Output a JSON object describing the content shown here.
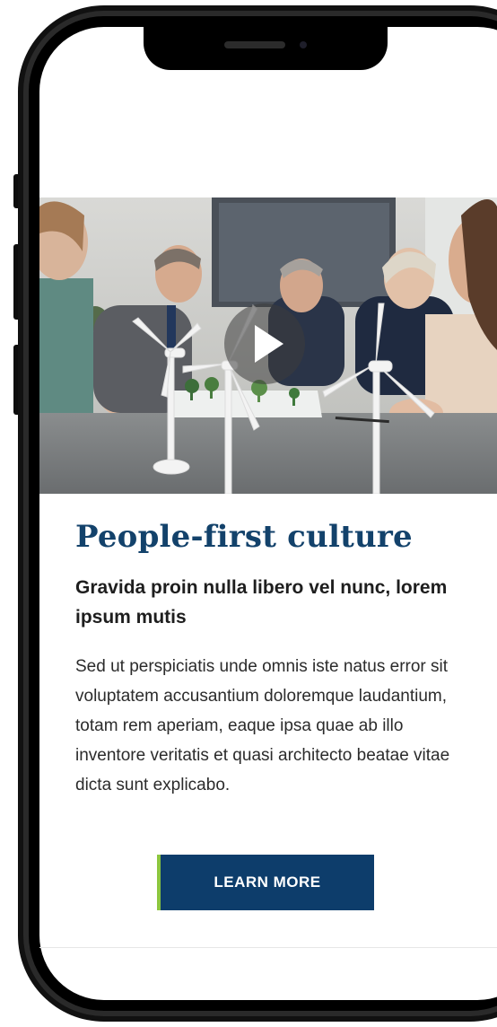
{
  "hero": {
    "media": "video-thumbnail",
    "play_icon": "play-icon"
  },
  "article": {
    "title": "People-first culture",
    "subtitle": "Gravida proin nulla libero vel nunc, lorem ipsum mutis",
    "body": "Sed ut perspiciatis unde omnis iste natus error sit voluptatem accusantium doloremque laudantium, totam rem aperiam, eaque ipsa quae ab illo inventore veritatis et quasi architecto beatae vitae dicta sunt explicabo.",
    "cta_label": "LEARN MORE"
  },
  "colors": {
    "title": "#13426b",
    "button": "#0d3d6b",
    "button_accent": "#8cc63f"
  }
}
